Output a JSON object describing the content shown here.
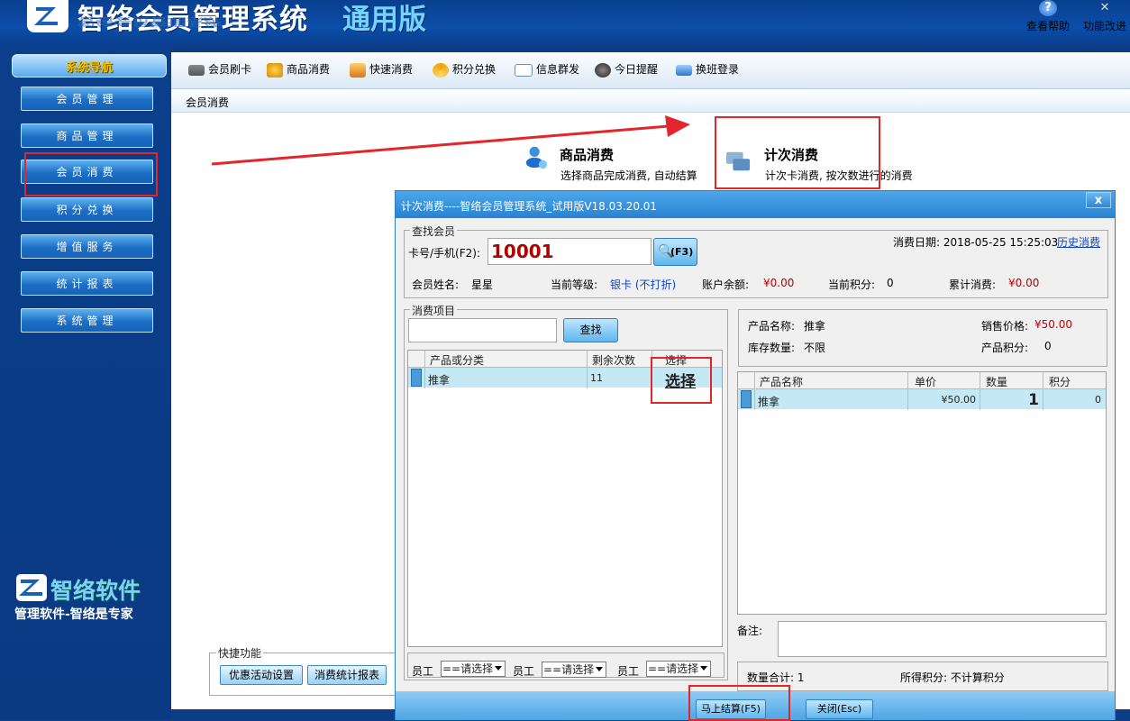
{
  "header": {
    "app_title": "智络会员管理系统",
    "app_edition": "通用版",
    "help_label": "查看帮助",
    "features_label": "功能改进"
  },
  "nav": {
    "title": "系统导航",
    "items": [
      {
        "label": "会员管理"
      },
      {
        "label": "商品管理"
      },
      {
        "label": "会员消费"
      },
      {
        "label": "积分兑换"
      },
      {
        "label": "增值服务"
      },
      {
        "label": "统计报表"
      },
      {
        "label": "系统管理"
      }
    ],
    "brand_name": "智络软件",
    "brand_slogan": "管理软件-智络是专家"
  },
  "toolbar": {
    "items": [
      {
        "label": "会员刷卡",
        "icon": "card-icon"
      },
      {
        "label": "商品消费",
        "icon": "money-bag-icon"
      },
      {
        "label": "快速消费",
        "icon": "fast-consume-icon"
      },
      {
        "label": "积分兑换",
        "icon": "exchange-icon"
      },
      {
        "label": "信息群发",
        "icon": "mail-icon"
      },
      {
        "label": "今日提醒",
        "icon": "clock-icon"
      },
      {
        "label": "换班登录",
        "icon": "switch-shift-icon"
      }
    ]
  },
  "breadcrumb": "会员消费",
  "modes": {
    "product": {
      "title": "商品消费",
      "desc": "选择商品完成消费, 自动结算"
    },
    "count": {
      "title": "计次消费",
      "desc": "计次卡消费, 按次数进行的消费"
    }
  },
  "shortcuts": {
    "legend": "快捷功能",
    "promo_button": "优惠活动设置",
    "stats_button": "消费统计报表"
  },
  "dialog": {
    "title": "计次消费----智络会员管理系统_试用版V18.03.20.01",
    "close_label": "x",
    "find_member": {
      "legend": "查找会员",
      "card_label": "卡号/手机(F2):",
      "card_value": "10001",
      "search_label": "(F3)",
      "date_label": "消费日期: 2018-05-25 15:25:03",
      "history_link": "历史消费",
      "name_label": "会员姓名:",
      "name_value": "星星",
      "level_label": "当前等级:",
      "level_value": "银卡 (不打折)",
      "balance_label": "账户余额:",
      "balance_value": "¥0.00",
      "points_label": "当前积分:",
      "points_value": "0",
      "total_label": "累计消费:",
      "total_value": "¥0.00"
    },
    "items": {
      "legend": "消费项目",
      "search_placeholder": "",
      "search_button": "查找",
      "columns": [
        "产品或分类",
        "剩余次数",
        "选择"
      ],
      "rows": [
        {
          "name": "推拿",
          "remaining": "11",
          "action": "选择"
        }
      ]
    },
    "product_info": {
      "name_label": "产品名称:",
      "name_value": "推拿",
      "price_label": "销售价格:",
      "price_value": "¥50.00",
      "stock_label": "库存数量:",
      "stock_value": "不限",
      "points_label": "产品积分:",
      "points_value": "0"
    },
    "cart": {
      "columns": [
        "产品名称",
        "单价",
        "数量",
        "积分"
      ],
      "rows": [
        {
          "name": "推拿",
          "price": "¥50.00",
          "qty": "1",
          "points": "0"
        }
      ]
    },
    "notes_label": "备注:",
    "staff_label": "员工",
    "staff_placeholder": "==请选择",
    "summary": {
      "qty_label": "数量合计: 1",
      "points_label": "所得积分: 不计算积分"
    },
    "checkout_button": "马上结算(F5)",
    "close_button": "关闭(Esc)"
  }
}
